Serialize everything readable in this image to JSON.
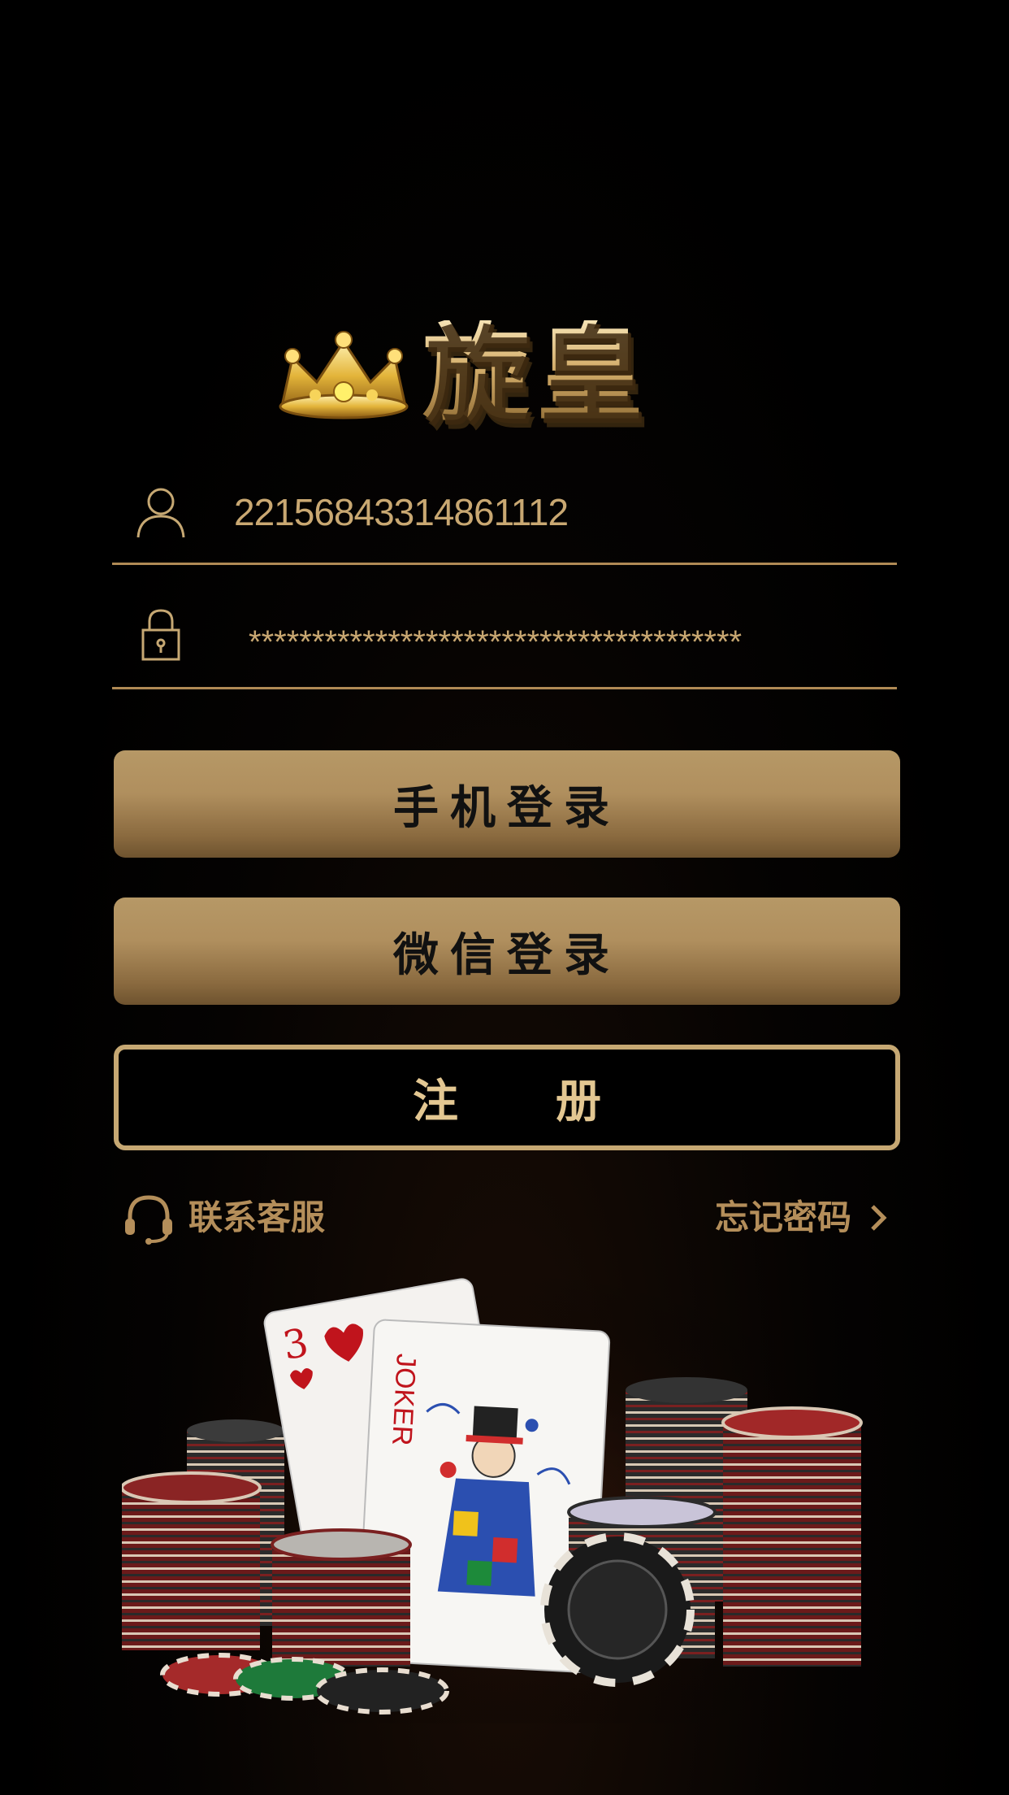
{
  "logo": {
    "text": "旋皇"
  },
  "login": {
    "account_value": "22156843314861112",
    "password_value": "***************************************"
  },
  "buttons": {
    "phone_login": "手机登录",
    "wechat_login": "微信登录",
    "register": "注册"
  },
  "links": {
    "customer_service": "联系客服",
    "forgot_password": "忘记密码"
  },
  "card": {
    "rank": "3",
    "joker_label": "JOKER"
  },
  "colors": {
    "background": "#000000",
    "gold": "#c6a873",
    "gold_text": "#c9a872",
    "divider": "#b08a55"
  }
}
